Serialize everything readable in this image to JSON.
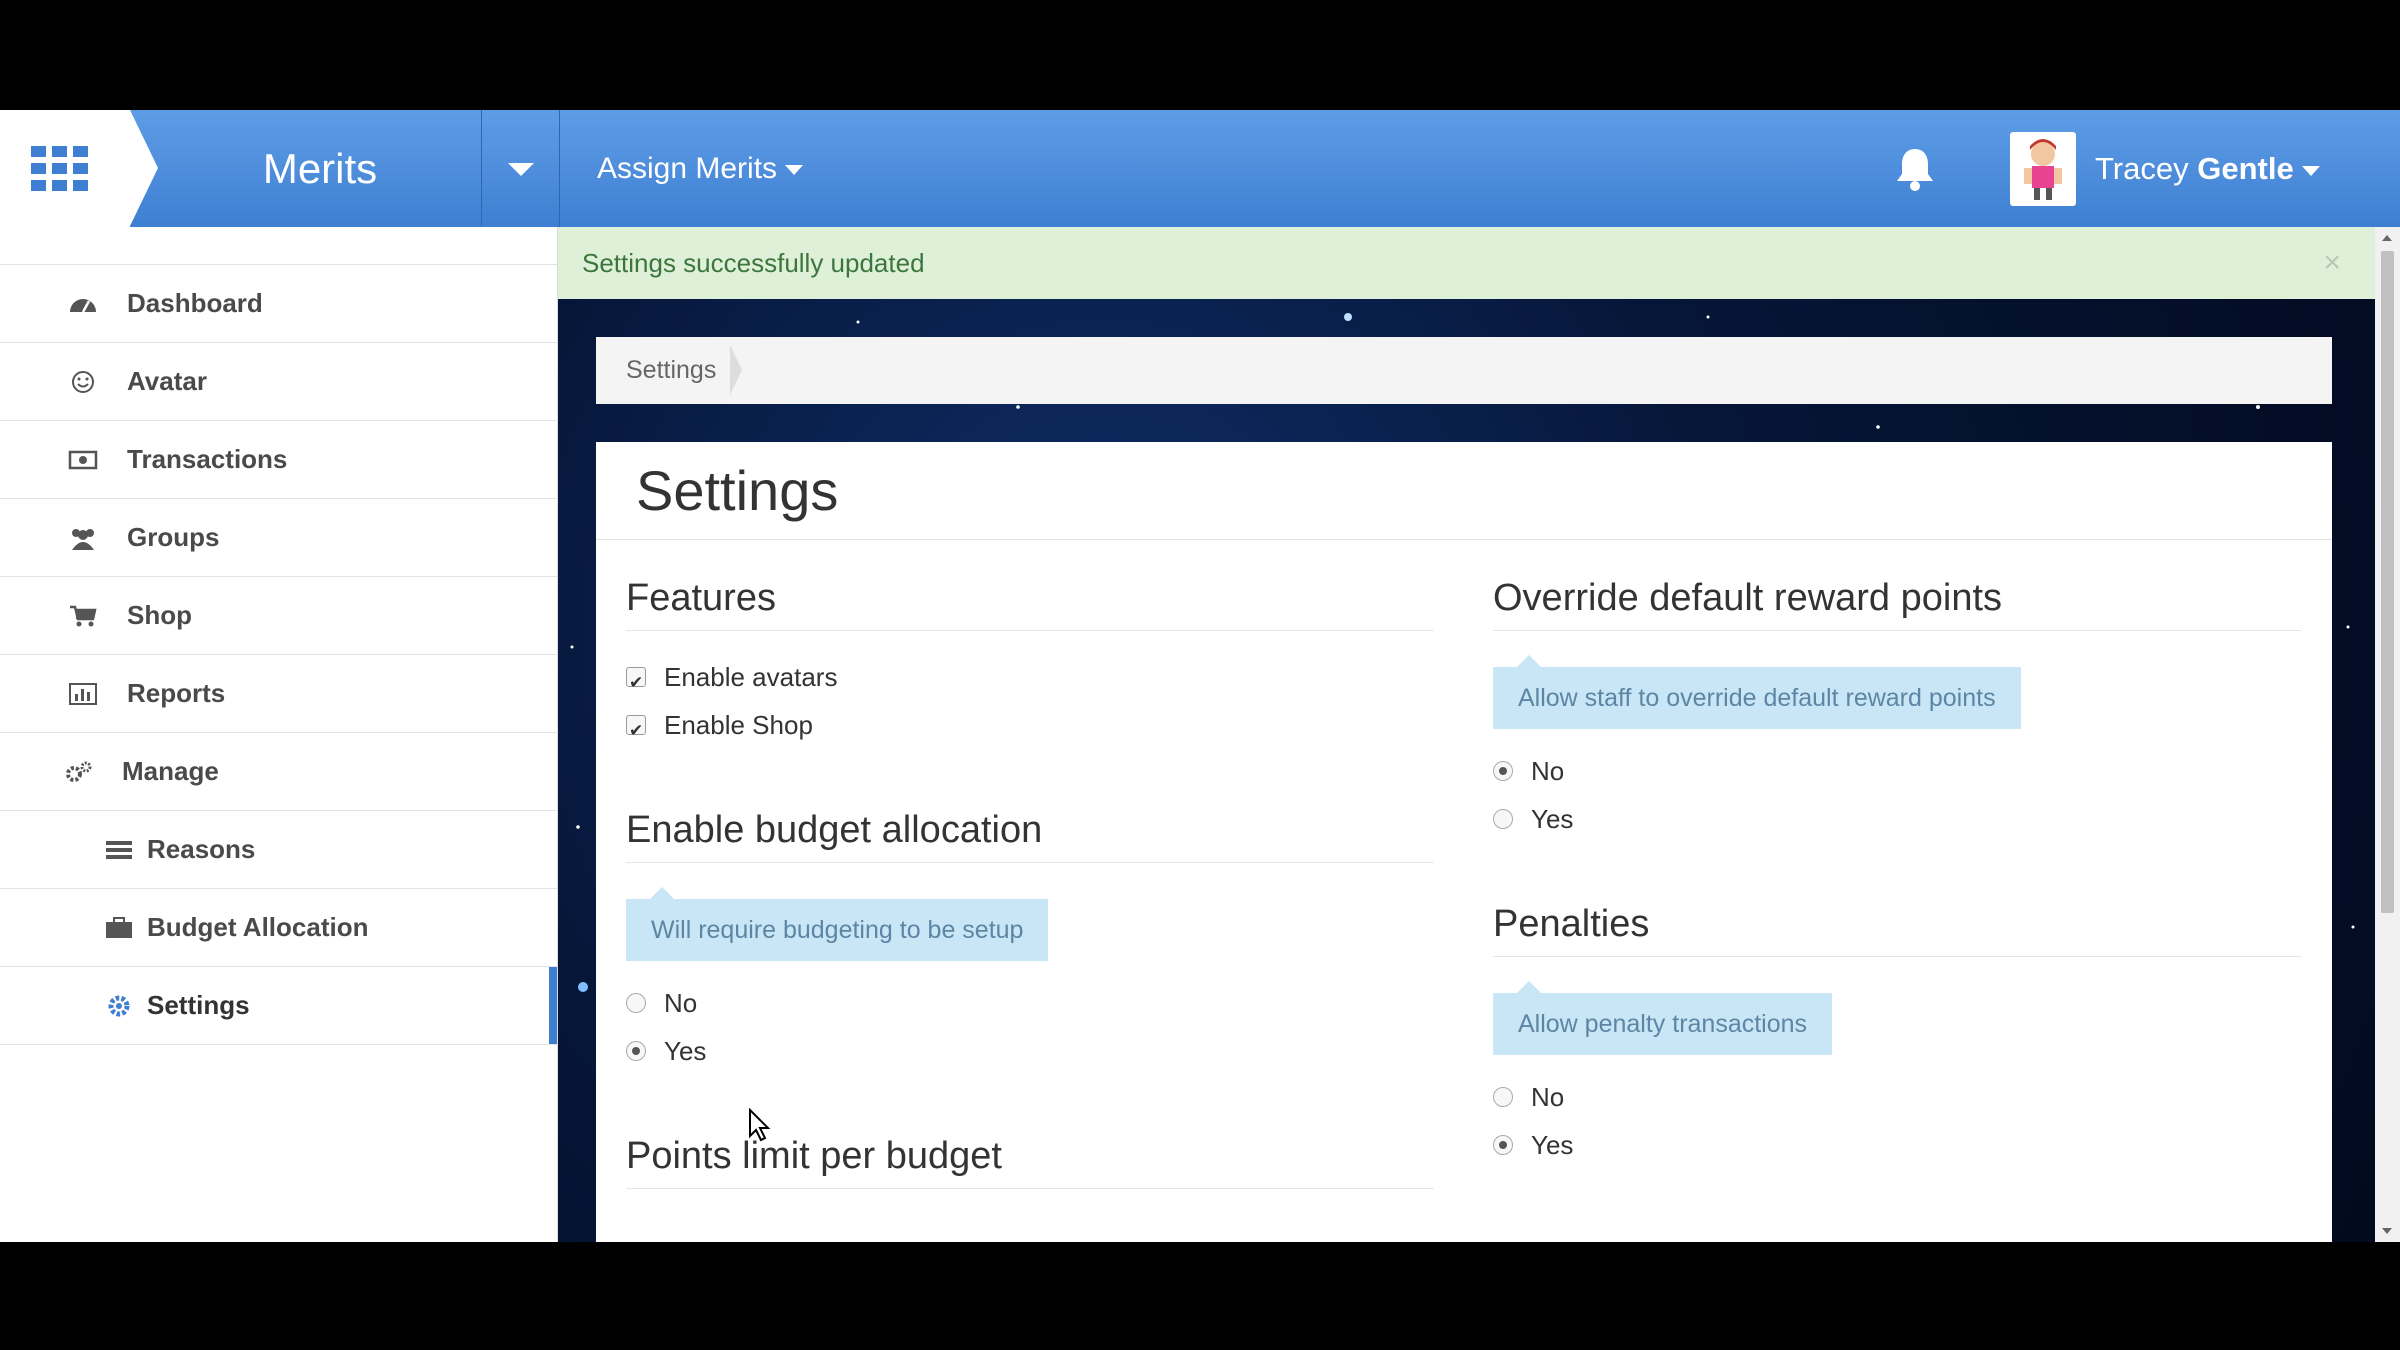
{
  "header": {
    "brand": "Merits",
    "assign_menu": "Assign Merits",
    "user_first": "Tracey",
    "user_last": "Gentle",
    "accent": "#3f7fd2"
  },
  "sidebar": {
    "items": [
      {
        "label": "Dashboard",
        "icon": "dashboard-icon"
      },
      {
        "label": "Avatar",
        "icon": "smile-icon"
      },
      {
        "label": "Transactions",
        "icon": "money-icon"
      },
      {
        "label": "Groups",
        "icon": "users-icon"
      },
      {
        "label": "Shop",
        "icon": "cart-icon"
      },
      {
        "label": "Reports",
        "icon": "bar-chart-icon"
      },
      {
        "label": "Manage",
        "icon": "cogs-icon"
      },
      {
        "label": "Reasons",
        "icon": "list-icon"
      },
      {
        "label": "Budget Allocation",
        "icon": "briefcase-icon"
      },
      {
        "label": "Settings",
        "icon": "gear-icon"
      }
    ]
  },
  "alert": {
    "message": "Settings successfully updated",
    "close": "×"
  },
  "breadcrumb": {
    "current": "Settings"
  },
  "page": {
    "title": "Settings"
  },
  "features": {
    "heading": "Features",
    "enable_avatars": "Enable avatars",
    "enable_shop": "Enable Shop"
  },
  "budget": {
    "heading": "Enable budget allocation",
    "hint": "Will require budgeting to be setup",
    "no": "No",
    "yes": "Yes",
    "selected": "Yes"
  },
  "points_limit": {
    "heading": "Points limit per budget"
  },
  "override": {
    "heading": "Override default reward points",
    "hint": "Allow staff to override default reward points",
    "no": "No",
    "yes": "Yes",
    "selected": "No"
  },
  "penalties": {
    "heading": "Penalties",
    "hint": "Allow penalty transactions",
    "no": "No",
    "yes": "Yes",
    "selected": "Yes"
  }
}
